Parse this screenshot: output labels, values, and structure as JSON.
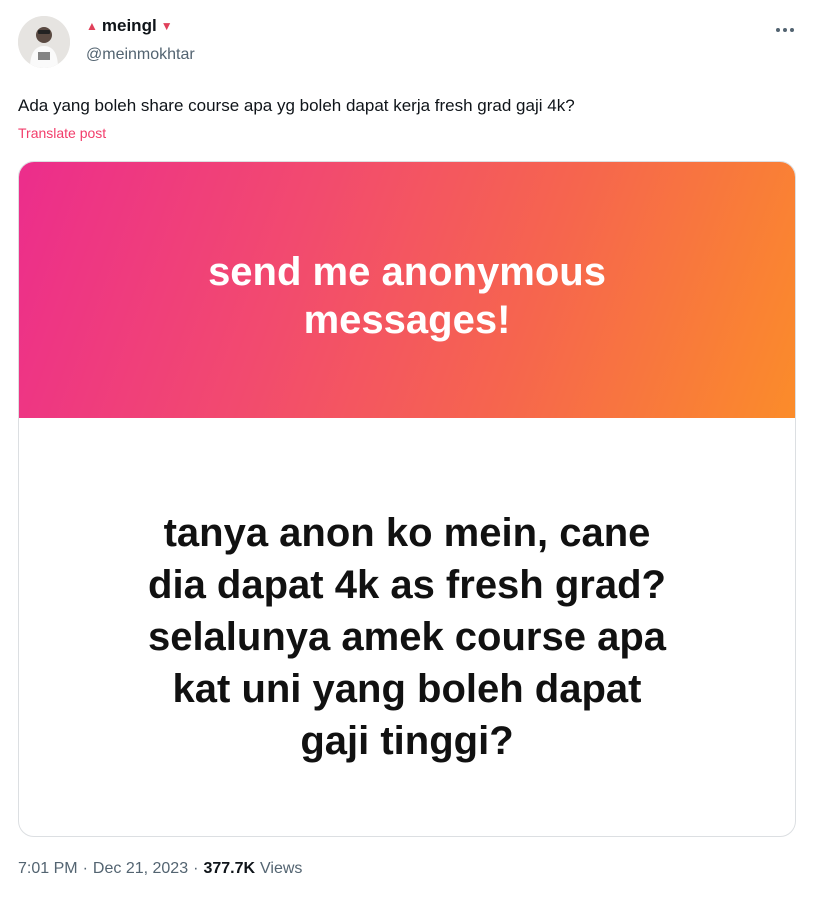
{
  "author": {
    "display_name": "meingl",
    "marker_before": "▲",
    "marker_after": "▼",
    "handle": "@meinmokhtar"
  },
  "menu": {
    "more_label": "···"
  },
  "post": {
    "text": "Ada yang boleh share course apa yg boleh dapat kerja fresh grad gaji 4k?",
    "translate_label": "Translate post"
  },
  "card": {
    "banner_lines": [
      "send me anonymous",
      "messages!"
    ],
    "question_lines": [
      "tanya anon ko mein, cane",
      "dia dapat 4k as fresh grad?",
      "selalunya amek course apa",
      "kat uni yang boleh dapat",
      "gaji tinggi?"
    ],
    "gradient_colors": [
      "#ec2d8c",
      "#f24a6f",
      "#f6654e",
      "#fb8c2a"
    ]
  },
  "meta": {
    "time": "7:01 PM",
    "separator": "·",
    "date": "Dec 21, 2023",
    "views_count": "377.7K",
    "views_label": "Views"
  },
  "colors": {
    "accent": "#f23d6b",
    "marker": "#e0405a",
    "secondary_text": "#536471"
  },
  "icons": {
    "avatar": "profile-photo",
    "more": "more-dots-icon"
  }
}
